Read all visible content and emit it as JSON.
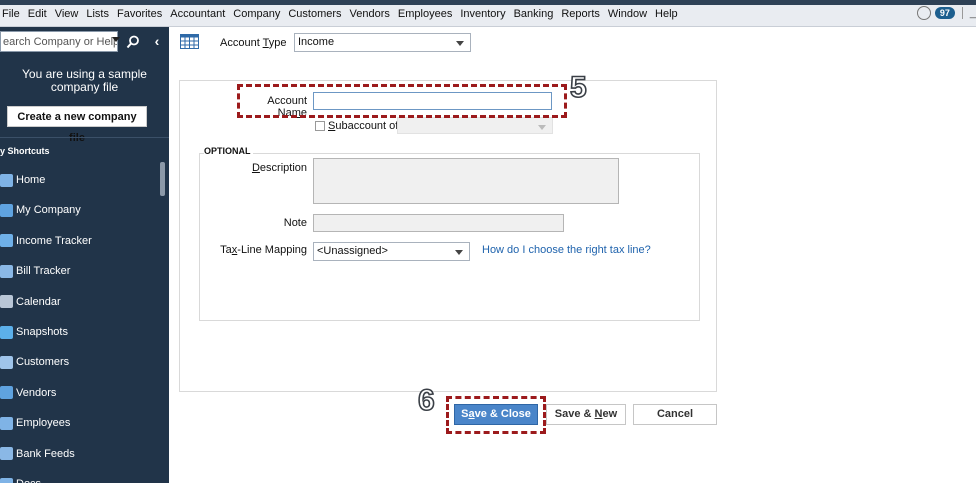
{
  "menubar": {
    "items": [
      "File",
      "Edit",
      "View",
      "Lists",
      "Favorites",
      "Accountant",
      "Company",
      "Customers",
      "Vendors",
      "Employees",
      "Inventory",
      "Banking",
      "Reports",
      "Window",
      "Help"
    ],
    "reminder_count": "97",
    "right_dash": "_"
  },
  "sidebar": {
    "search_placeholder": "earch Company or Help",
    "collapse_glyph": "‹",
    "sample_message": "You are using a sample company file",
    "create_button": "Create a new company file",
    "shortcuts_header": "y Shortcuts",
    "shortcuts": [
      {
        "label": "Home",
        "icon": "home-icon"
      },
      {
        "label": "My Company",
        "icon": "my-company-icon"
      },
      {
        "label": "Income Tracker",
        "icon": "income-tracker-icon"
      },
      {
        "label": "Bill Tracker",
        "icon": "bill-tracker-icon"
      },
      {
        "label": "Calendar",
        "icon": "calendar-icon"
      },
      {
        "label": "Snapshots",
        "icon": "snapshots-icon"
      },
      {
        "label": "Customers",
        "icon": "customers-icon"
      },
      {
        "label": "Vendors",
        "icon": "vendors-icon"
      },
      {
        "label": "Employees",
        "icon": "employees-icon"
      },
      {
        "label": "Bank Feeds",
        "icon": "bank-feeds-icon"
      },
      {
        "label": "Docs",
        "icon": "docs-icon"
      }
    ]
  },
  "form": {
    "account_type_label_pre": "Account ",
    "account_type_label_ul": "T",
    "account_type_label_post": "ype",
    "account_type_value": "Income",
    "account_name_label_pre": "Account Na",
    "account_name_label_ul": "m",
    "account_name_label_post": "e",
    "account_name_value": "",
    "subaccount_label_ul": "S",
    "subaccount_label_post": "ubaccount of",
    "optional_label": "OPTIONAL",
    "description_label_ul": "D",
    "description_label_post": "escription",
    "note_label": "Note",
    "taxline_label_pre": "Ta",
    "taxline_label_ul": "x",
    "taxline_label_post": "-Line Mapping",
    "taxline_value": "<Unassigned>",
    "taxline_help_link": "How do I choose the right tax line?"
  },
  "buttons": {
    "save_close_pre": "S",
    "save_close_ul": "a",
    "save_close_post": "ve & Close",
    "save_new_pre": "Save & ",
    "save_new_ul": "N",
    "save_new_post": "ew",
    "cancel": "Cancel"
  },
  "annotations": {
    "step_account_name": "5",
    "step_save_close": "6",
    "color": "#9c1a1c"
  }
}
